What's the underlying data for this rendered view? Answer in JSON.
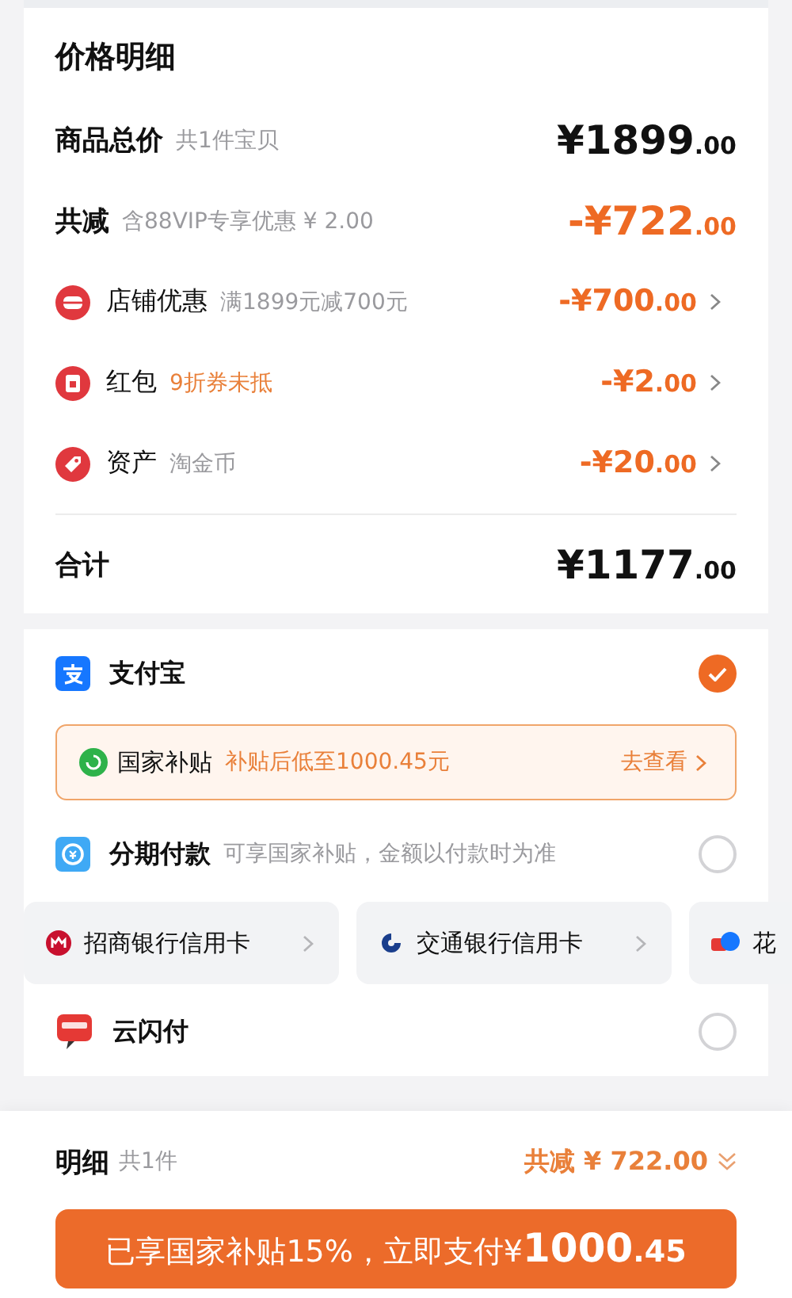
{
  "header": {
    "title": "价格明细"
  },
  "summary": [
    {
      "kind": "total",
      "label": "商品总价",
      "note": "共1件宝贝",
      "amount": "¥1899",
      "cents": ".00"
    },
    {
      "kind": "discount",
      "label": "共减",
      "note": "含88VIP专享优惠 ¥ 2.00",
      "amount": "-¥722",
      "cents": ".00"
    }
  ],
  "discounts": [
    {
      "label": "店铺优惠",
      "note": "满1899元减700元",
      "highlighted": false,
      "amount": "-¥700",
      "cents": ".00"
    },
    {
      "label": "红包",
      "note": "9折券未抵",
      "highlighted": true,
      "amount": "-¥2",
      "cents": ".00"
    },
    {
      "label": "资产",
      "note": "淘金币",
      "highlighted": false,
      "amount": "-¥20",
      "cents": ".00"
    }
  ],
  "total": {
    "label": "合计",
    "amount": "¥1177",
    "cents": ".00"
  },
  "payment_methods": [
    {
      "kind": "option",
      "name": "支付宝",
      "selected": true
    },
    {
      "kind": "banner",
      "label": "国家补贴",
      "note": "补贴后低至1000.45元",
      "link": "去查看"
    },
    {
      "kind": "option",
      "name": "分期付款",
      "note": "可享国家补贴，金额以付款时为准",
      "selected": false
    },
    {
      "kind": "chips",
      "chips": [
        {
          "label": "招商银行信用卡"
        },
        {
          "label": "交通银行信用卡"
        },
        {
          "label": "花"
        }
      ]
    },
    {
      "kind": "option",
      "name": "云闪付",
      "selected": false
    }
  ],
  "footer": {
    "label": "明细",
    "count": "共1件",
    "saving": "共减 ¥ 722.00",
    "pay_text": "已享国家补贴15%，立即支付¥",
    "pay_amount": "1000",
    "pay_cents": ".45"
  }
}
